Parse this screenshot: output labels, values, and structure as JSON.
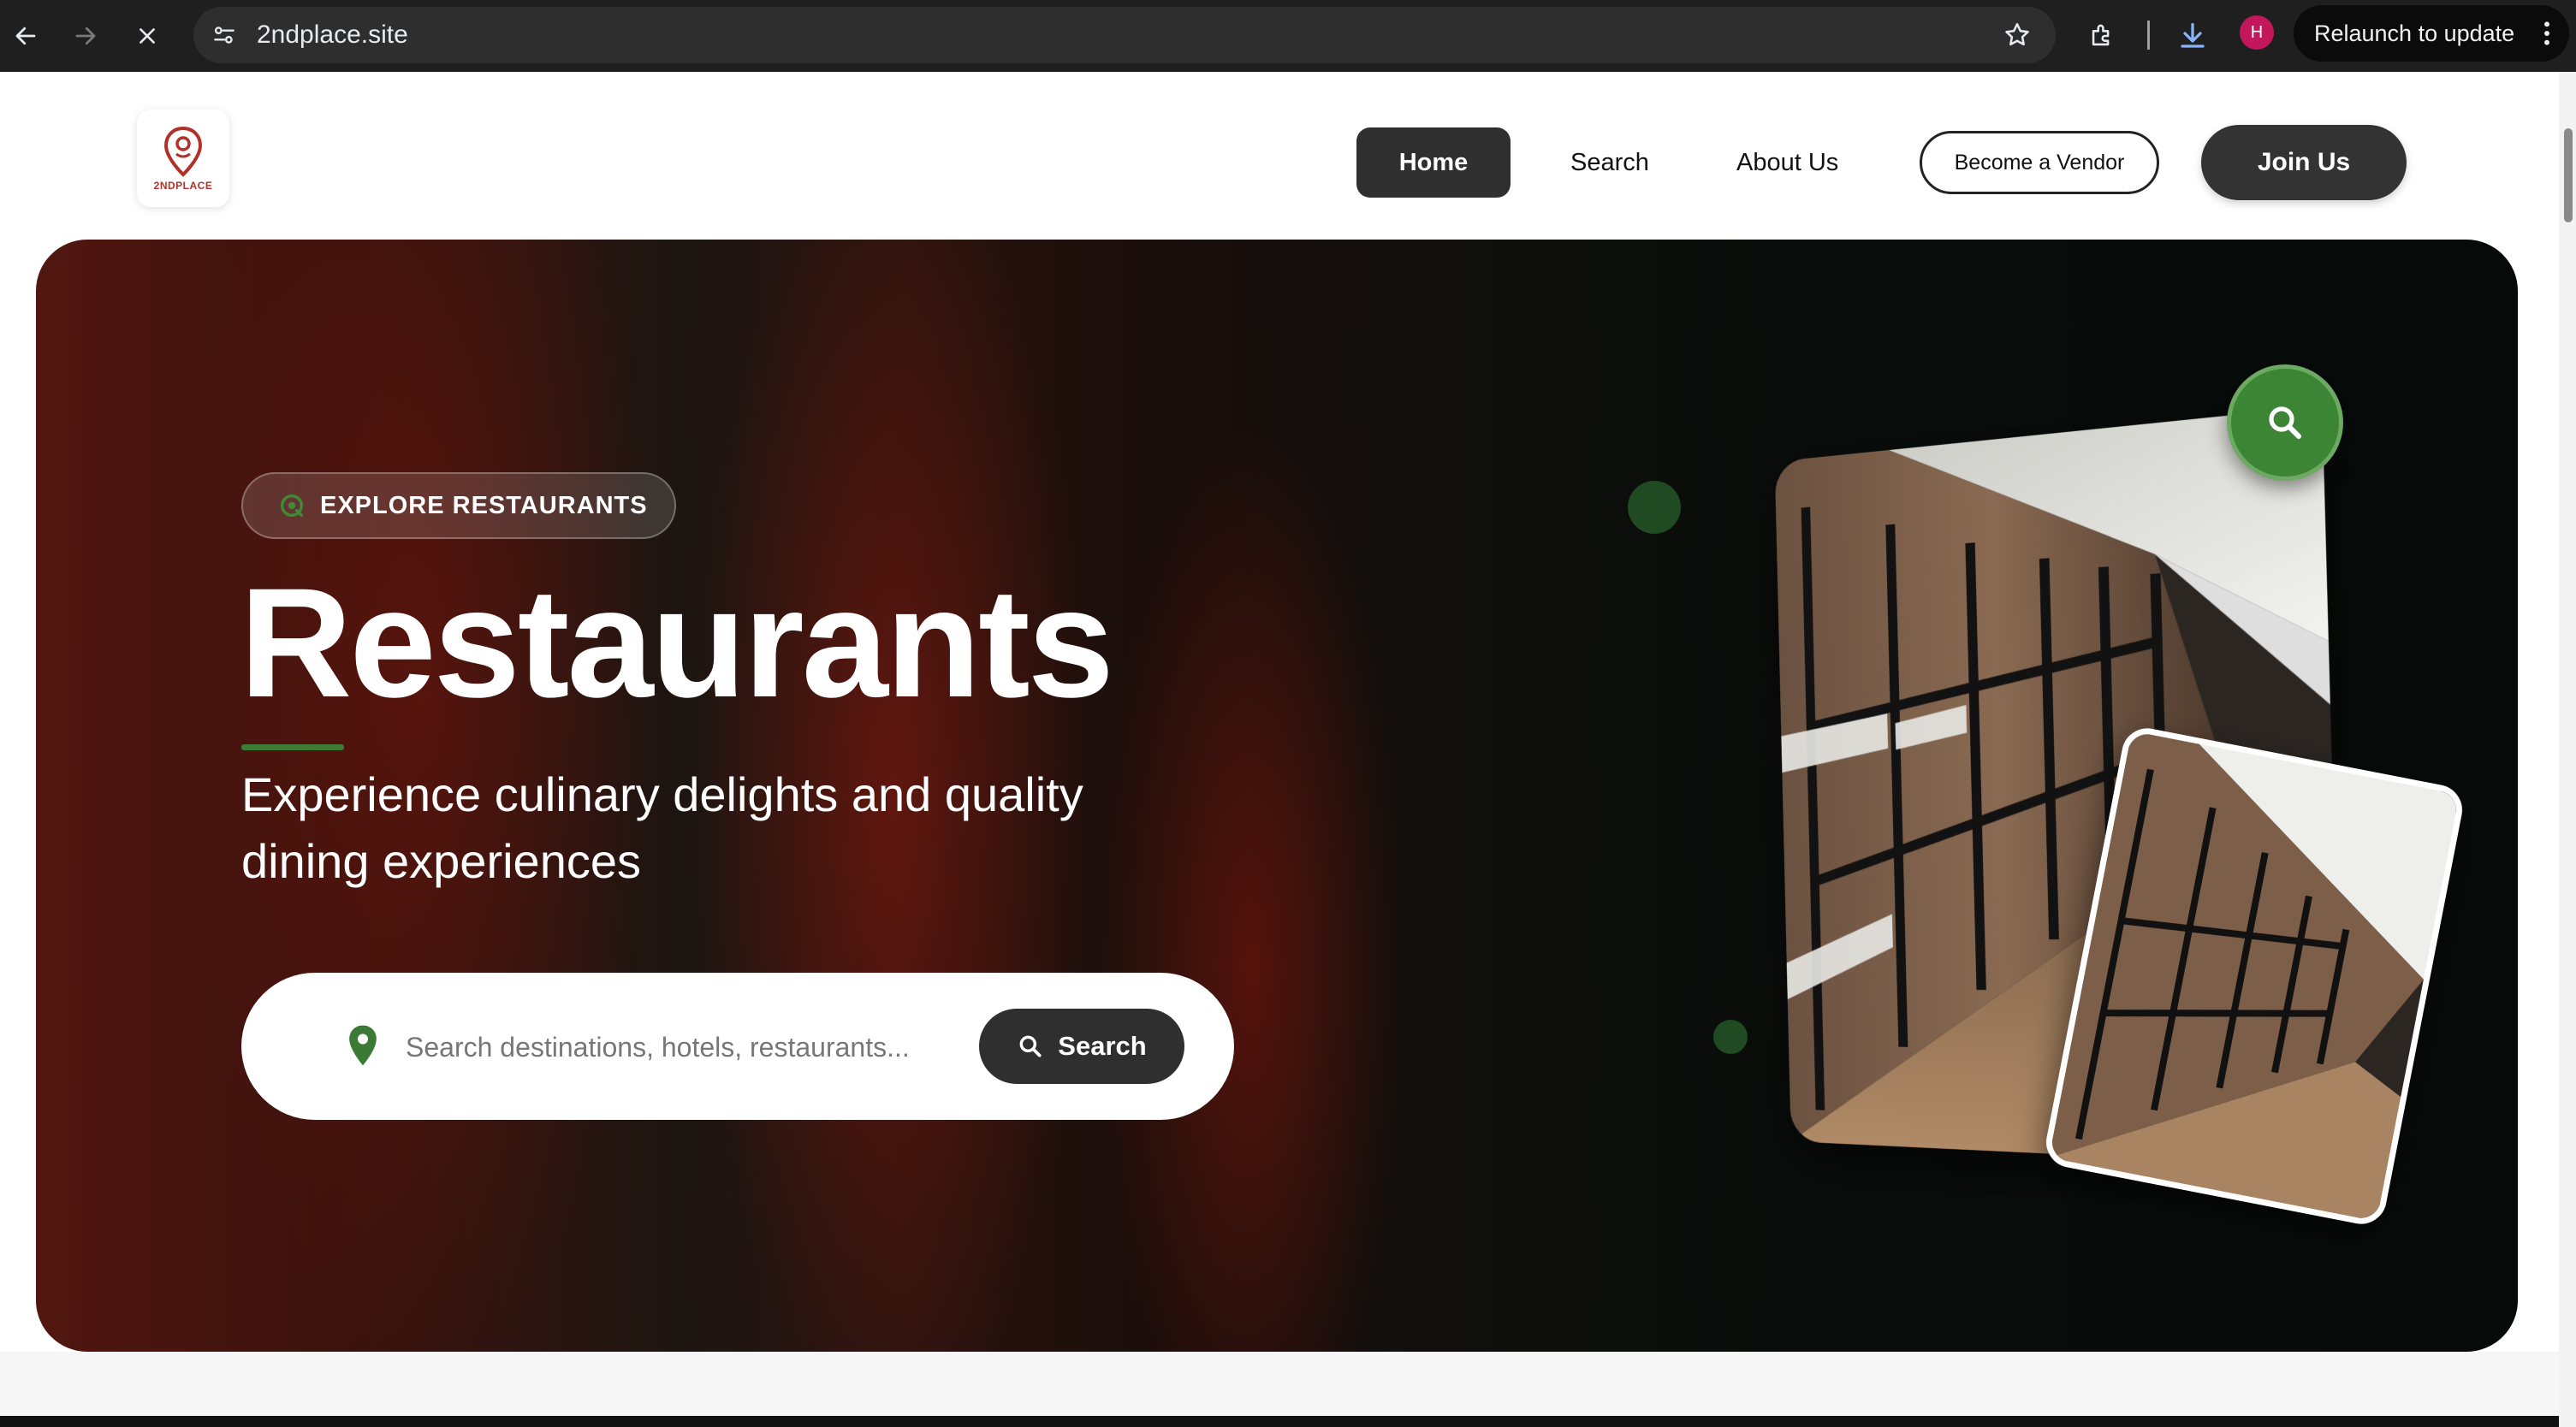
{
  "browser": {
    "url": "2ndplace.site",
    "relaunch_label": "Relaunch to update",
    "profile_initial": "H"
  },
  "header": {
    "logo_text": "2NDPLACE",
    "nav": {
      "home": "Home",
      "search": "Search",
      "about": "About Us"
    },
    "vendor_label": "Become a Vendor",
    "join_label": "Join Us"
  },
  "hero": {
    "badge": "EXPLORE RESTAURANTS",
    "title": "Restaurants",
    "subtitle": "Experience culinary delights and quality dining experiences",
    "search": {
      "placeholder": "Search destinations, hotels, restaurants...",
      "button_label": "Search"
    }
  },
  "colors": {
    "accent_green": "#3b8534",
    "dark_button": "#2f2f2f",
    "logo_red": "#b0322a"
  }
}
